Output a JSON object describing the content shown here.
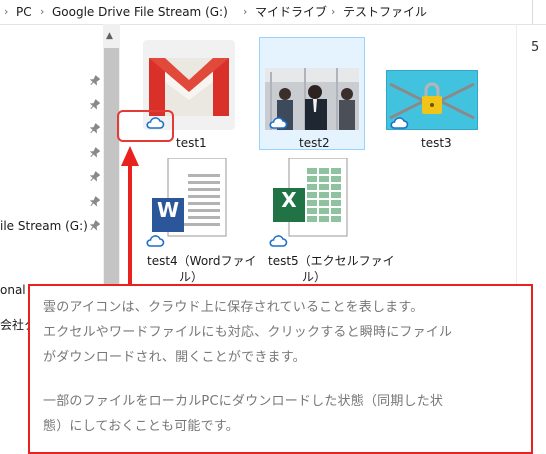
{
  "breadcrumb": {
    "items": [
      "PC",
      "Google Drive File Stream (G:)",
      "マイドライブ",
      "テストファイル"
    ],
    "separator": "›"
  },
  "nav_pane": {
    "items": [
      "ile Stream (G:)",
      "onal",
      "会社ク"
    ]
  },
  "right_pane": {
    "text": "5 "
  },
  "files": [
    {
      "name": "test1",
      "thumb": "gmail-envelope",
      "cloud": "cloud-icon"
    },
    {
      "name": "test2",
      "thumb": "photo-commuters",
      "cloud": "cloud-icon",
      "selected": true
    },
    {
      "name": "test3",
      "thumb": "padlock-chains",
      "cloud": "cloud-icon"
    },
    {
      "name": "test4（Wordファイル）",
      "name_line1": "test4（Wordファイ",
      "name_line2": "ル）",
      "thumb": "word-document",
      "cloud": "cloud-icon"
    },
    {
      "name": "test5（エクセルファイル）",
      "name_line1": "test5（エクセルファイ",
      "name_line2": "ル）",
      "thumb": "excel-document",
      "cloud": "cloud-icon"
    }
  ],
  "word_letter": "W",
  "excel_letter": "X",
  "callout": {
    "lines": [
      "雲のアイコンは、クラウド上に保存されていることを表します。",
      "エクセルやワードファイルにも対応、クリックすると瞬時にファイル",
      "がダウンロードされ、開くことができます。",
      "",
      "一部のファイルをローカルPCにダウンロードした状態（同期した状",
      "態）にしておくことも可能です。"
    ]
  },
  "colors": {
    "annotation_red": "#e8231f",
    "selection_bg": "#e5f3ff",
    "selection_border": "#99d1ff",
    "cloud_blue": "#1e6fc8",
    "word_blue": "#2b579a",
    "excel_green": "#217346"
  }
}
